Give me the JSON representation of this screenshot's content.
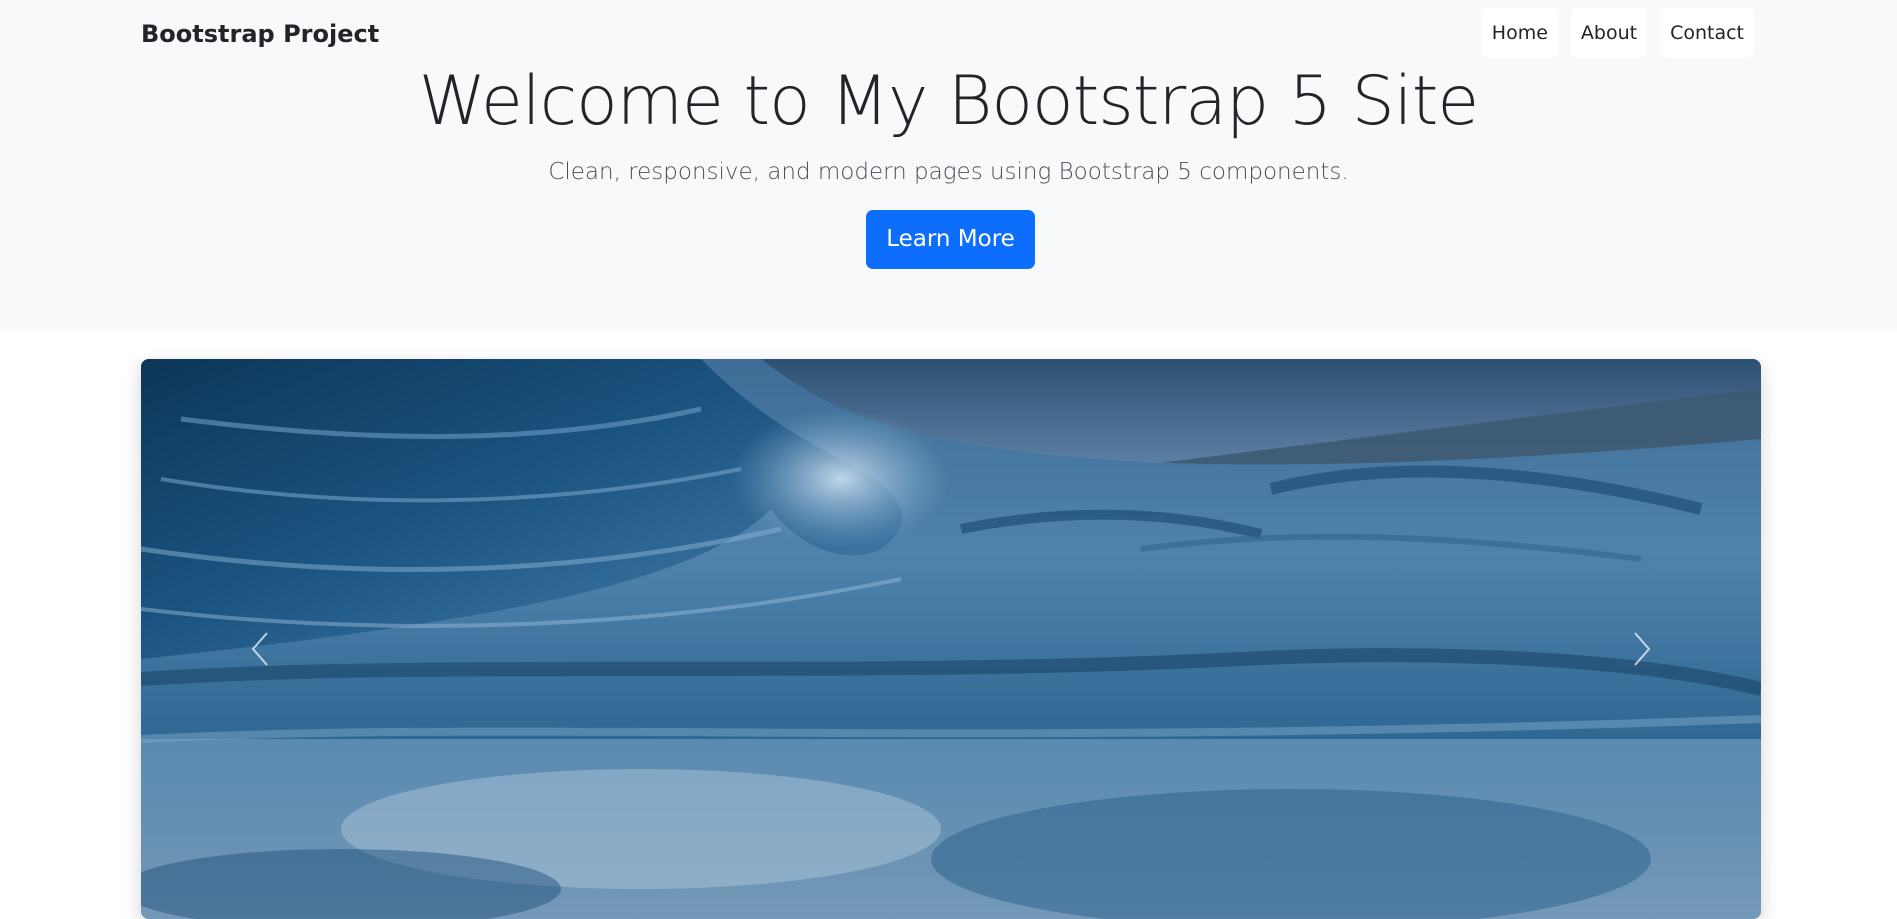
{
  "navbar": {
    "brand": "Bootstrap Project",
    "links": [
      {
        "label": "Home"
      },
      {
        "label": "About"
      },
      {
        "label": "Contact"
      }
    ]
  },
  "hero": {
    "title": "Welcome to My Bootstrap 5 Site",
    "lead": "Clean, responsive, and modern pages using Bootstrap 5 components.",
    "button_label": "Learn More"
  },
  "carousel": {
    "image": "ocean-wave-photo",
    "prev_icon": "chevron-left-icon",
    "next_icon": "chevron-right-icon"
  },
  "colors": {
    "hero_background": "#f8f9fa",
    "primary": "#0d6efd",
    "text": "#212529",
    "muted_text": "#495057"
  }
}
